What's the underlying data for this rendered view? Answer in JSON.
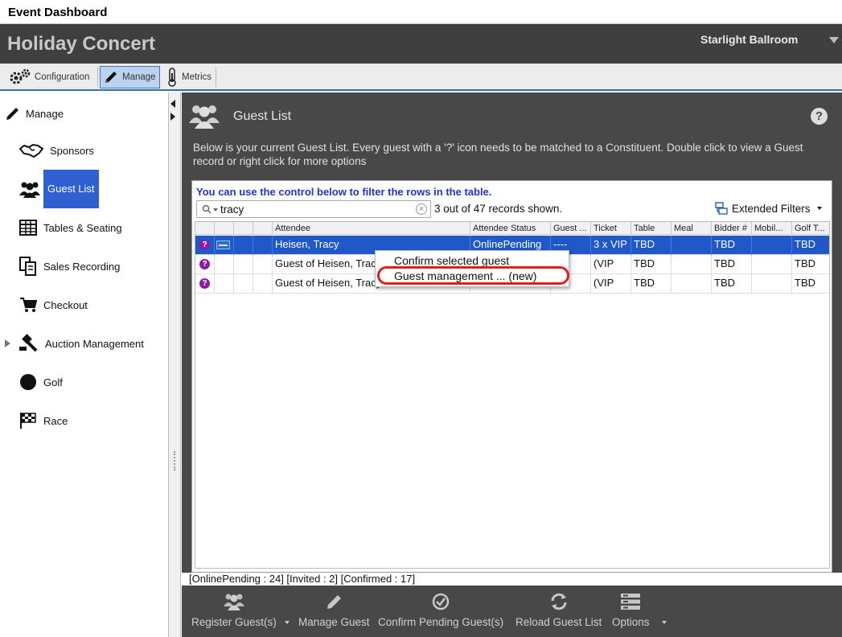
{
  "window": {
    "title": "Event Dashboard"
  },
  "header": {
    "event_title": "Holiday Concert",
    "venue": "Starlight Ballroom"
  },
  "toolbar": {
    "configuration": "Configuration",
    "manage": "Manage",
    "metrics": "Metrics"
  },
  "sidebar": {
    "heading": "Manage",
    "items": [
      {
        "label": "Sponsors",
        "icon": "handshake-icon"
      },
      {
        "label": "Guest List",
        "icon": "people-icon",
        "selected": true
      },
      {
        "label": "Tables & Seating",
        "icon": "table-grid-icon"
      },
      {
        "label": "Sales Recording",
        "icon": "documents-icon"
      },
      {
        "label": "Checkout",
        "icon": "cart-icon"
      },
      {
        "label": "Auction Management",
        "icon": "gavel-icon",
        "expandable": true
      },
      {
        "label": "Golf",
        "icon": "golf-ball-icon"
      },
      {
        "label": "Race",
        "icon": "checkered-flag-icon"
      }
    ]
  },
  "main": {
    "title": "Guest List",
    "description": "Below is your current Guest List. Every guest with a '?' icon needs to be matched to a Constituent. Double click to view a Guest record or right click for more options",
    "filter_hint": "You can use the control below to filter the rows in the table.",
    "search_value": "tracy",
    "records_shown": "3 out of 47 records shown.",
    "extended_filters": "Extended Filters",
    "columns": [
      "",
      "",
      "",
      "",
      "Attendee",
      "Attendee Status",
      "Guest ...",
      "Ticket",
      "Table",
      "Meal",
      "Bidder #",
      "Mobil...",
      "Golf T..."
    ],
    "rows": [
      {
        "attendee": "Heisen, Tracy",
        "status": "OnlinePending",
        "guest": "----",
        "ticket": "3 x VIP",
        "table": "TBD",
        "meal": "",
        "bidder": "TBD",
        "mobile": "",
        "golf": "TBD",
        "selected": true
      },
      {
        "attendee": "Guest of Heisen, Tracy",
        "status": "",
        "guest": "e...",
        "ticket": "(VIP",
        "table": "TBD",
        "meal": "",
        "bidder": "TBD",
        "mobile": "",
        "golf": "TBD",
        "selected": false
      },
      {
        "attendee": "Guest of Heisen, Tracy",
        "status": "",
        "guest": "...",
        "ticket": "(VIP",
        "table": "TBD",
        "meal": "",
        "bidder": "TBD",
        "mobile": "",
        "golf": "TBD",
        "selected": false
      }
    ],
    "status_summary": "[OnlinePending : 24] [Invited : 2] [Confirmed : 17]"
  },
  "context_menu": {
    "items": [
      "Confirm selected guest",
      "Guest management ... (new)"
    ],
    "highlight_color": "#e02020"
  },
  "bottom_bar": {
    "register": "Register Guest(s)",
    "manage": "Manage Guest",
    "confirm": "Confirm Pending Guest(s)",
    "reload": "Reload Guest List",
    "options": "Options"
  },
  "colors": {
    "accent": "#2059c7",
    "header_bg": "#3f3f3f",
    "panel_bg": "#484848",
    "question_icon": "#8b1aa6"
  }
}
